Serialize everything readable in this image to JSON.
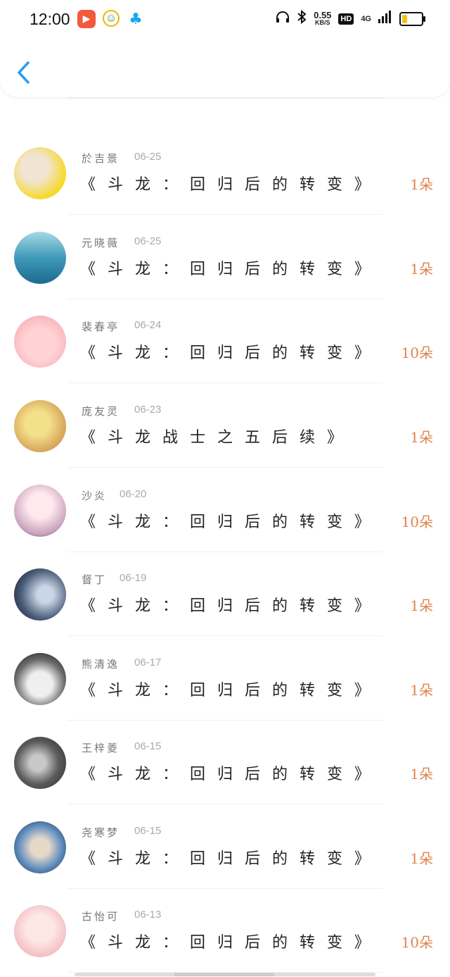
{
  "status_bar": {
    "time": "12:00",
    "speed_value": "0.55",
    "speed_unit": "KB/S",
    "hd": "HD",
    "network": "4G",
    "battery_level": 0.25,
    "icons": [
      "headphones-icon",
      "bluetooth-icon",
      "signal-icon",
      "battery-icon"
    ]
  },
  "header": {
    "back_icon": "chevron-left-icon"
  },
  "colors": {
    "accent_blue": "#2a9df4",
    "amount_orange": "#e0844c",
    "name_gray": "#777777",
    "date_gray": "#aaaaaa"
  },
  "records": [
    {
      "name": "",
      "date": "",
      "title": "《 斗 龙 ： 回 归 后 的 转 变 》",
      "amount": "1朵"
    },
    {
      "name": "於吉景",
      "date": "06-25",
      "title": "《 斗 龙 ： 回 归 后 的 转 变 》",
      "amount": "1朵"
    },
    {
      "name": "元晓薇",
      "date": "06-25",
      "title": "《 斗 龙 ： 回 归 后 的 转 变 》",
      "amount": "1朵"
    },
    {
      "name": "裴春亭",
      "date": "06-24",
      "title": "《 斗 龙 ： 回 归 后 的 转 变 》",
      "amount": "10朵"
    },
    {
      "name": "庞友灵",
      "date": "06-23",
      "title": "《 斗 龙 战 士 之 五 后 续 》",
      "amount": "1朵"
    },
    {
      "name": "沙炎",
      "date": "06-20",
      "title": "《 斗 龙 ： 回 归 后 的 转 变 》",
      "amount": "10朵"
    },
    {
      "name": "督丁",
      "date": "06-19",
      "title": "《 斗 龙 ： 回 归 后 的 转 变 》",
      "amount": "1朵"
    },
    {
      "name": "熊清逸",
      "date": "06-17",
      "title": "《 斗 龙 ： 回 归 后 的 转 变 》",
      "amount": "1朵"
    },
    {
      "name": "王梓菱",
      "date": "06-15",
      "title": "《 斗 龙 ： 回 归 后 的 转 变 》",
      "amount": "1朵"
    },
    {
      "name": "尧寒梦",
      "date": "06-15",
      "title": "《 斗 龙 ： 回 归 后 的 转 变 》",
      "amount": "1朵"
    },
    {
      "name": "古怡可",
      "date": "06-13",
      "title": "《 斗 龙 ： 回 归 后 的 转 变 》",
      "amount": "10朵"
    }
  ]
}
